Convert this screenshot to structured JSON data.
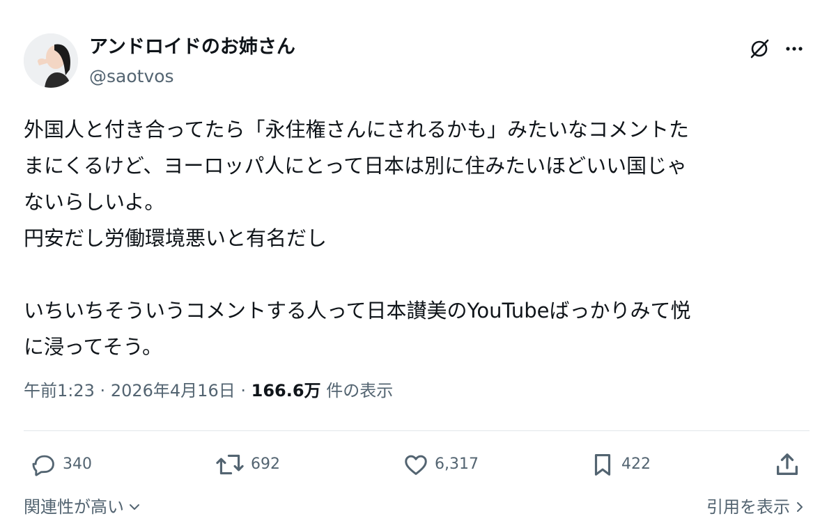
{
  "author": {
    "display_name": "アンドロイドのお姉さん",
    "handle": "@saotvos",
    "avatar_icon": "profile-photo"
  },
  "header_icons": {
    "grok": "grok-icon",
    "more": "more-horizontal-icon"
  },
  "tweet": {
    "lines": [
      "外国人と付き合ってたら「永住権さんにされるかも」みたいなコメントた",
      "まにくるけど、ヨーロッパ人にとって日本は別に住みたいほどいい国じゃ",
      "ないらしいよ。",
      "円安だし労働環境悪いと有名だし",
      "",
      "いちいちそういうコメントする人って日本讃美のYouTubeばっかりみて悦",
      "に浸ってそう。"
    ]
  },
  "meta": {
    "time": "午前1:23",
    "separator": "·",
    "date": "2026年4月16日",
    "views_count": "166.6万",
    "views_label": "件の表示"
  },
  "actions": {
    "reply": {
      "count": "340",
      "icon": "reply-icon"
    },
    "repost": {
      "count": "692",
      "icon": "repost-icon"
    },
    "like": {
      "count": "6,317",
      "icon": "heart-icon"
    },
    "bookmark": {
      "count": "422",
      "icon": "bookmark-icon"
    },
    "share": {
      "icon": "share-icon"
    }
  },
  "footer": {
    "sort_label": "関連性が高い",
    "quotes_label": "引用を表示"
  },
  "colors": {
    "text_primary": "#0f1419",
    "text_secondary": "#536471",
    "divider": "#e1e6ea",
    "background": "#ffffff"
  }
}
